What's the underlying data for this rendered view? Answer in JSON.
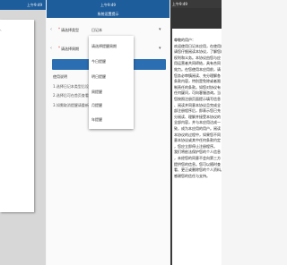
{
  "left_panel": {
    "status_time": "上午9:49",
    "sheet_text": "、"
  },
  "middle_panel": {
    "status_time": "上午9:49",
    "title": "系统设置提示",
    "rows": [
      {
        "label": "请选择类型",
        "value": "日记本",
        "chevron": "▾",
        "left_mark": "‹"
      },
      {
        "label": "请选择周期",
        "value": "",
        "chevron": "▾",
        "left_mark": "‹"
      }
    ],
    "confirm_button": "",
    "notes_title": "使用说明",
    "notes": [
      "1.选择日记本类型后设置提醒周期",
      "2.选择后可在首页查看提醒记录",
      "3.如需取消提醒请重新设置"
    ],
    "dropdown_items": [
      "请选择提醒周期",
      "今日提醒",
      "明日提醒",
      "周提醒",
      "月提醒",
      "年提醒"
    ]
  },
  "right_panel": {
    "status_time": "上午9:49",
    "doc_lines": [
      "尊敬的用户：",
      "欢迎使用日记本应用，在使用前",
      "请您仔细阅读本协议，了解您的",
      "权利和义务。本协议由您与应",
      "用运营者共同缔结，具有合同",
      "效力。在您使用本应用前，请",
      "您务必审慎阅读、充分理解各",
      "条款内容，特别是免除或者限",
      "制责任的条款。如您对协议有",
      "任何疑问，可向客服咨询。当",
      "您按照注册页面提示填写信息",
      "、阅读并同意本协议且完成全",
      "部注册程序后，即表示您已充",
      "分阅读、理解并接受本协议的",
      "全部内容，并与本应用达成一",
      "致，成为本应用的用户。阅读",
      "本协议的过程中，如果您不同",
      "意本协议或其中任何条款约定",
      "，您应立即停止注册程序。",
      "我们将依法保护您的个人信息",
      "，未经您的同意不会向第三方",
      "提供您的信息。您可以随时查",
      "看、更正或删除您的个人资料。",
      "感谢您的信任与支持。"
    ]
  }
}
